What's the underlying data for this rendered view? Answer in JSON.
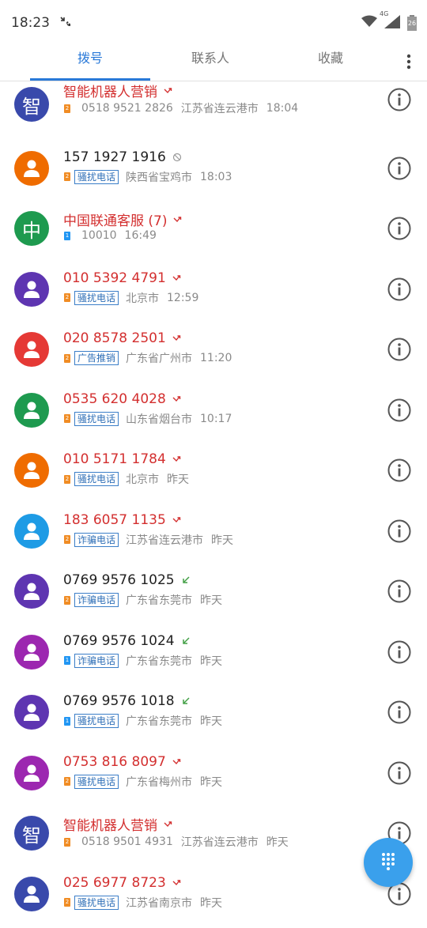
{
  "status": {
    "time": "18:23",
    "network": "4G",
    "battery": "26"
  },
  "tabs": [
    {
      "label": "拨号",
      "active": true
    },
    {
      "label": "联系人",
      "active": false
    },
    {
      "label": "收藏",
      "active": false
    }
  ],
  "calls": [
    {
      "avatar_text": "智",
      "avatar_color": "#3949ab",
      "name": "智能机器人营销",
      "name_color": "red",
      "call_icon": "missed-call-icon",
      "sim": "2",
      "tag": "",
      "number": "0518 9521 2826",
      "location": "江苏省连云港市",
      "time": "18:04"
    },
    {
      "avatar_text": "",
      "avatar_color": "#ef6c00",
      "name": "157 1927 1916",
      "name_color": "black",
      "call_icon": "blocked-call-icon",
      "sim": "2",
      "tag": "骚扰电话",
      "number": "",
      "location": "陕西省宝鸡市",
      "time": "18:03"
    },
    {
      "avatar_text": "中",
      "avatar_color": "#1e9a4f",
      "name": "中国联通客服 (7)",
      "name_color": "red",
      "call_icon": "missed-call-icon",
      "sim": "1",
      "tag": "",
      "number": "10010",
      "location": "",
      "time": "16:49"
    },
    {
      "avatar_text": "",
      "avatar_color": "#5e35b1",
      "name": "010 5392 4791",
      "name_color": "red",
      "call_icon": "missed-call-icon",
      "sim": "2",
      "tag": "骚扰电话",
      "number": "",
      "location": "北京市",
      "time": "12:59"
    },
    {
      "avatar_text": "",
      "avatar_color": "#e53935",
      "name": "020 8578 2501",
      "name_color": "red",
      "call_icon": "missed-call-icon",
      "sim": "2",
      "tag": "广告推销",
      "number": "",
      "location": "广东省广州市",
      "time": "11:20"
    },
    {
      "avatar_text": "",
      "avatar_color": "#1e9a4f",
      "name": "0535 620 4028",
      "name_color": "red",
      "call_icon": "missed-call-icon",
      "sim": "2",
      "tag": "骚扰电话",
      "number": "",
      "location": "山东省烟台市",
      "time": "10:17"
    },
    {
      "avatar_text": "",
      "avatar_color": "#ef6c00",
      "name": "010 5171 1784",
      "name_color": "red",
      "call_icon": "missed-call-icon",
      "sim": "2",
      "tag": "骚扰电话",
      "number": "",
      "location": "北京市",
      "time": "昨天"
    },
    {
      "avatar_text": "",
      "avatar_color": "#1e9be5",
      "name": "183 6057 1135",
      "name_color": "red",
      "call_icon": "missed-call-icon",
      "sim": "2",
      "tag": "诈骗电话",
      "number": "",
      "location": "江苏省连云港市",
      "time": "昨天"
    },
    {
      "avatar_text": "",
      "avatar_color": "#5e35b1",
      "name": "0769 9576 1025",
      "name_color": "black",
      "call_icon": "incoming-call-icon",
      "sim": "2",
      "tag": "诈骗电话",
      "number": "",
      "location": "广东省东莞市",
      "time": "昨天"
    },
    {
      "avatar_text": "",
      "avatar_color": "#9c27b0",
      "name": "0769 9576 1024",
      "name_color": "black",
      "call_icon": "incoming-call-icon",
      "sim": "1",
      "tag": "诈骗电话",
      "number": "",
      "location": "广东省东莞市",
      "time": "昨天"
    },
    {
      "avatar_text": "",
      "avatar_color": "#5e35b1",
      "name": "0769 9576 1018",
      "name_color": "black",
      "call_icon": "incoming-call-icon",
      "sim": "1",
      "tag": "骚扰电话",
      "number": "",
      "location": "广东省东莞市",
      "time": "昨天"
    },
    {
      "avatar_text": "",
      "avatar_color": "#9c27b0",
      "name": "0753 816 8097",
      "name_color": "red",
      "call_icon": "missed-call-icon",
      "sim": "2",
      "tag": "骚扰电话",
      "number": "",
      "location": "广东省梅州市",
      "time": "昨天"
    },
    {
      "avatar_text": "智",
      "avatar_color": "#3949ab",
      "name": "智能机器人营销",
      "name_color": "red",
      "call_icon": "missed-call-icon",
      "sim": "2",
      "tag": "",
      "number": "0518 9501 4931",
      "location": "江苏省连云港市",
      "time": "昨天"
    },
    {
      "avatar_text": "",
      "avatar_color": "#3949ab",
      "name": "025 6977 8723",
      "name_color": "red",
      "call_icon": "missed-call-icon",
      "sim": "2",
      "tag": "骚扰电话",
      "number": "",
      "location": "江苏省南京市",
      "time": "昨天"
    }
  ]
}
